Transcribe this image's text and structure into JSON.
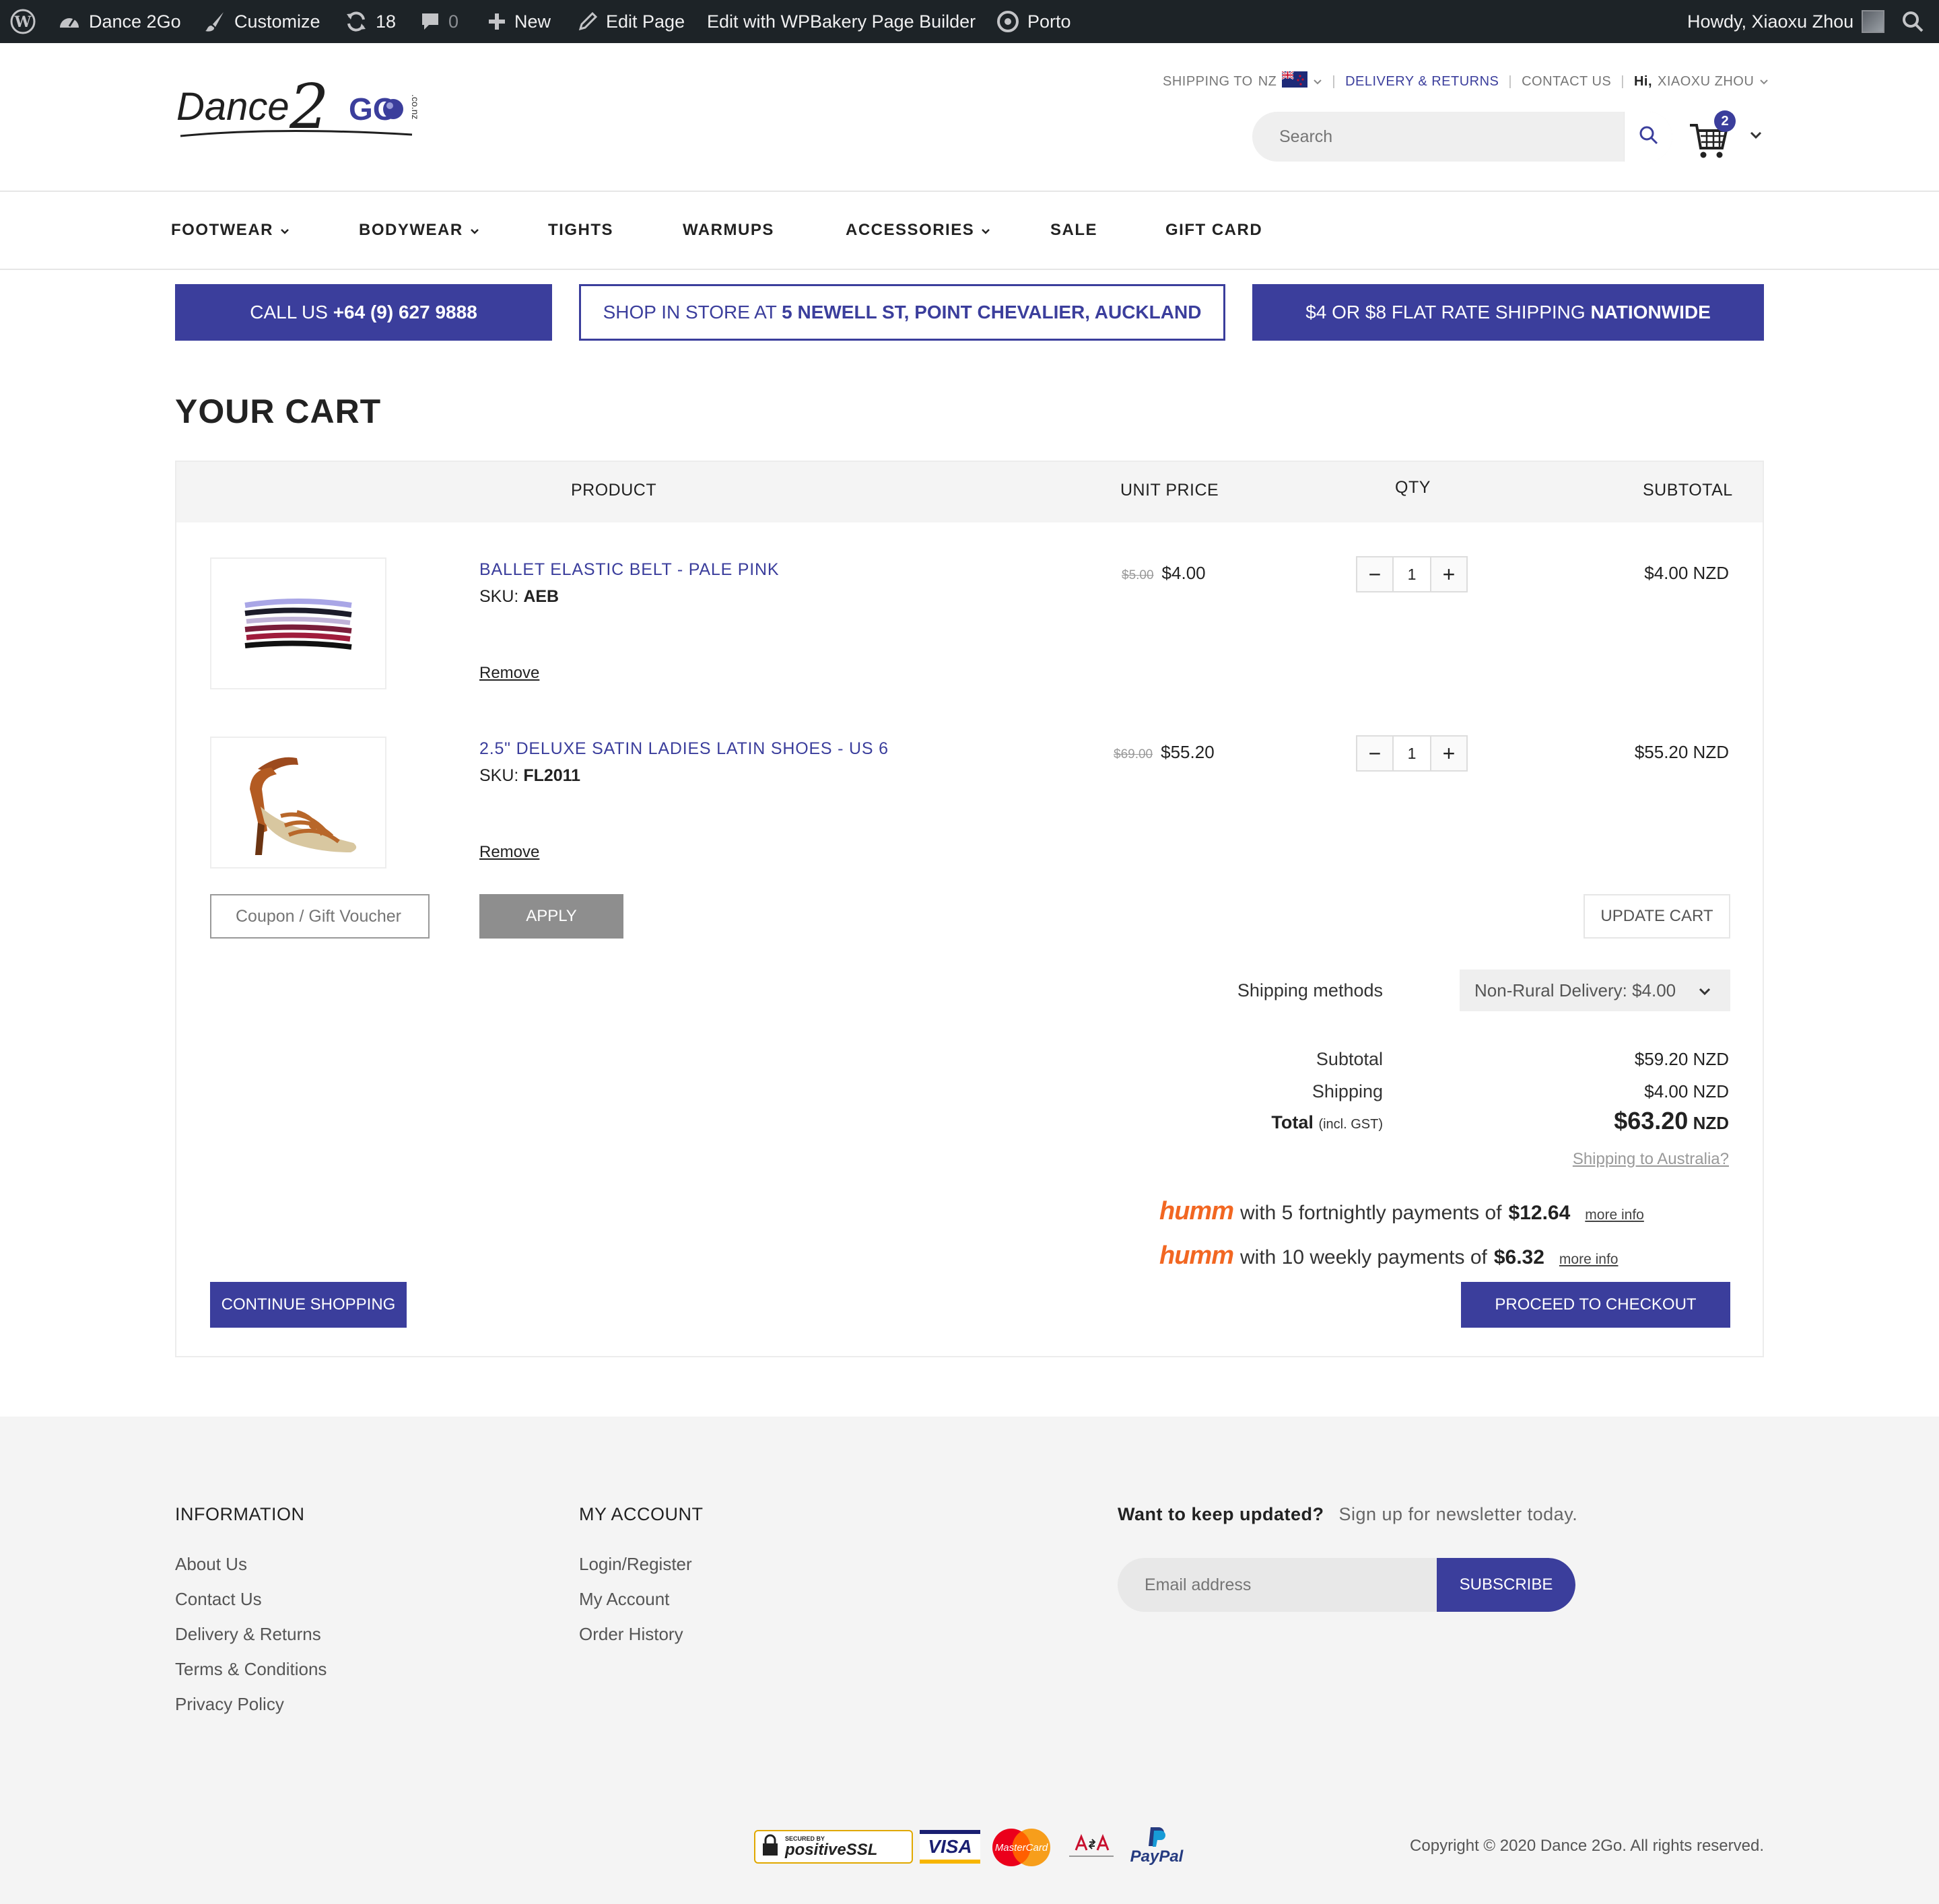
{
  "admin_bar": {
    "site_name": "Dance 2Go",
    "customize": "Customize",
    "updates_count": "18",
    "comments_count": "0",
    "new_label": "New",
    "edit_page": "Edit Page",
    "edit_wpbakery": "Edit with WPBakery Page Builder",
    "theme": "Porto",
    "howdy": "Howdy, Xiaoxu Zhou"
  },
  "header": {
    "logo_text": "Dance",
    "logo_two": "2",
    "logo_go": "GO",
    "logo_tld": ".co.nz",
    "shipping_to_label": "SHIPPING TO",
    "shipping_country": "NZ",
    "delivery_link": "DELIVERY & RETURNS",
    "contact_link": "CONTACT US",
    "hi_label": "Hi,",
    "user_name": "XIAOXU ZHOU",
    "search_placeholder": "Search",
    "cart_count": "2"
  },
  "nav": {
    "items": [
      {
        "label": "FOOTWEAR"
      },
      {
        "label": "BODYWEAR"
      },
      {
        "label": "TIGHTS"
      },
      {
        "label": "WARMUPS"
      },
      {
        "label": "ACCESSORIES"
      },
      {
        "label": "SALE"
      },
      {
        "label": "GIFT CARD"
      }
    ]
  },
  "banners": {
    "call_prefix": "CALL US ",
    "call_number": "+64 (9) 627 9888",
    "store_prefix": "SHOP IN STORE AT ",
    "store_address": "5 NEWELL ST, POINT CHEVALIER, AUCKLAND",
    "shipping_prefix": "$4 OR $8 FLAT RATE SHIPPING ",
    "shipping_bold": "NATIONWIDE"
  },
  "cart": {
    "title": "YOUR CART",
    "columns": {
      "product": "PRODUCT",
      "unit_price": "UNIT PRICE",
      "qty": "QTY",
      "subtotal": "SUBTOTAL"
    },
    "items": [
      {
        "name": "BALLET ELASTIC BELT - PALE PINK",
        "sku_label": "SKU:",
        "sku": "AEB",
        "old_price": "$5.00",
        "price": "$4.00",
        "qty": "1",
        "subtotal": "$4.00 NZD",
        "remove": "Remove"
      },
      {
        "name": "2.5\" DELUXE SATIN LADIES LATIN SHOES - US 6",
        "sku_label": "SKU:",
        "sku": "FL2011",
        "old_price": "$69.00",
        "price": "$55.20",
        "qty": "1",
        "subtotal": "$55.20 NZD",
        "remove": "Remove"
      }
    ],
    "coupon_placeholder": "Coupon / Gift Voucher",
    "apply": "APPLY",
    "update_cart": "UPDATE CART",
    "shipping_methods_label": "Shipping methods",
    "shipping_method_value": "Non-Rural Delivery: $4.00",
    "totals": {
      "subtotal_label": "Subtotal",
      "subtotal_value": "$59.20 NZD",
      "shipping_label": "Shipping",
      "shipping_value": "$4.00 NZD",
      "total_label": "Total",
      "total_note": "(incl. GST)",
      "total_amount": "$63.20",
      "total_currency": "NZD",
      "australia_link": "Shipping to Australia?"
    },
    "humm": [
      {
        "logo": "humm",
        "text": "with 5 fortnightly payments of",
        "amount": "$12.64",
        "more": "more info"
      },
      {
        "logo": "humm",
        "text": "with 10 weekly payments of",
        "amount": "$6.32",
        "more": "more info"
      }
    ],
    "continue": "CONTINUE SHOPPING",
    "checkout": "PROCEED TO CHECKOUT"
  },
  "footer": {
    "info_heading": "INFORMATION",
    "info_links": [
      "About Us",
      "Contact Us",
      "Delivery & Returns",
      "Terms & Conditions",
      "Privacy Policy"
    ],
    "account_heading": "MY ACCOUNT",
    "account_links": [
      "Login/Register",
      "My Account",
      "Order History"
    ],
    "newsletter_heading": "Want to keep updated?",
    "newsletter_sub": "Sign up for newsletter today.",
    "email_placeholder": "Email address",
    "subscribe": "SUBSCRIBE",
    "badges": {
      "ssl_secured": "SECURED BY",
      "ssl": "positiveSSL",
      "visa": "VISA",
      "mastercard": "MasterCard",
      "paypal": "PayPal"
    },
    "copyright": "Copyright © 2020 Dance 2Go. All rights reserved."
  },
  "colors": {
    "brand": "#3b3e9c",
    "admin_bar": "#1d2327",
    "humm": "#f26722"
  }
}
